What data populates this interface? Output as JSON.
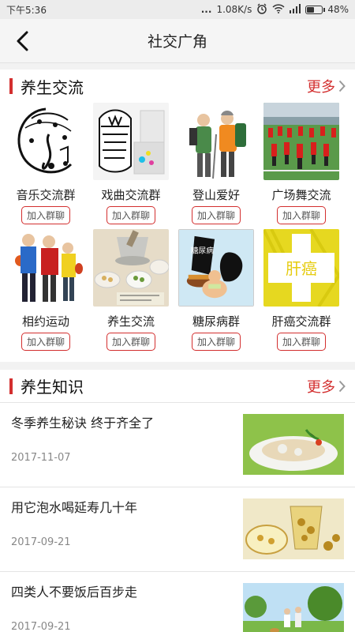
{
  "status": {
    "time": "下午5:36",
    "dots": "...",
    "speed": "1.08K/s",
    "battery": "48%",
    "battery_level": 0.48
  },
  "header": {
    "title": "社交广角"
  },
  "groups_section": {
    "title": "养生交流",
    "more": "更多",
    "join_label": "加入群聊",
    "items": [
      {
        "name": "音乐交流群"
      },
      {
        "name": "戏曲交流群"
      },
      {
        "name": "登山爱好"
      },
      {
        "name": "广场舞交流"
      },
      {
        "name": "相约运动"
      },
      {
        "name": "养生交流"
      },
      {
        "name": "糖尿病群",
        "thumb_text": "糖尿病"
      },
      {
        "name": "肝癌交流群",
        "thumb_text": "肝癌"
      }
    ]
  },
  "knowledge_section": {
    "title": "养生知识",
    "more": "更多",
    "items": [
      {
        "title": "冬季养生秘诀 终于齐全了",
        "date": "2017-11-07"
      },
      {
        "title": "用它泡水喝延寿几十年",
        "date": "2017-09-21"
      },
      {
        "title": "四类人不要饭后百步走",
        "date": "2017-09-21"
      }
    ]
  }
}
